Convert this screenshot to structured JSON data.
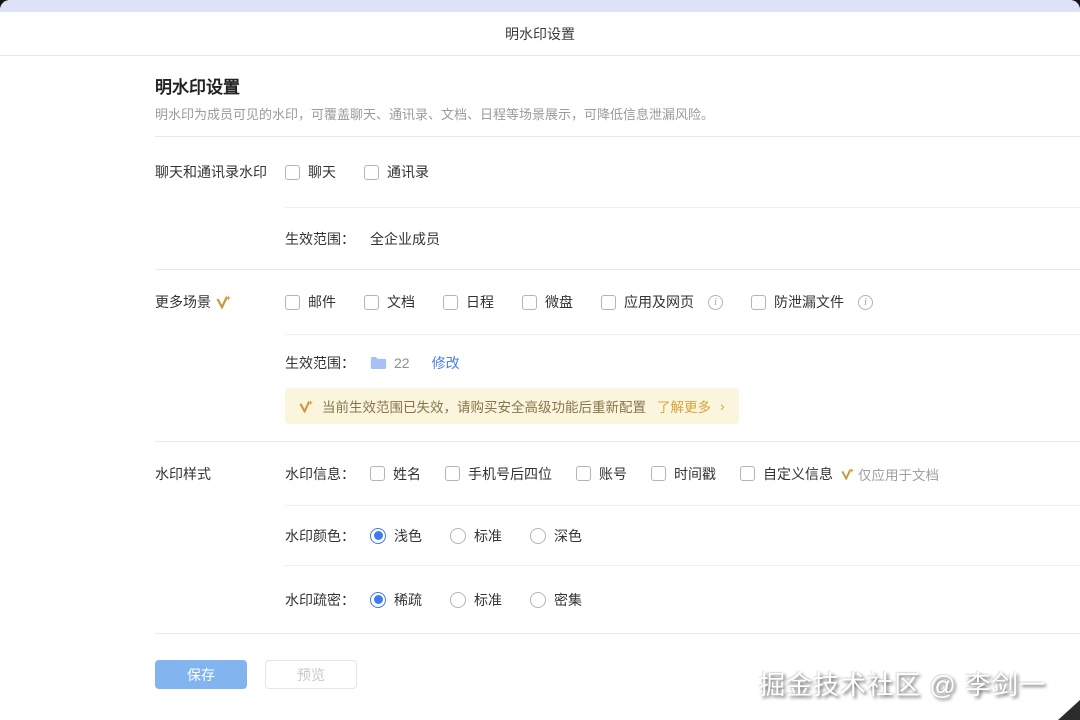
{
  "header": {
    "title": "明水印设置"
  },
  "page": {
    "title": "明水印设置",
    "subtitle": "明水印为成员可见的水印，可覆盖聊天、通讯录、文档、日程等场景展示，可降低信息泄漏风险。"
  },
  "section_chat": {
    "label": "聊天和通讯录水印",
    "checkboxes": [
      {
        "label": "聊天",
        "checked": false
      },
      {
        "label": "通讯录",
        "checked": false
      }
    ],
    "scope_label": "生效范围：",
    "scope_value": "全企业成员"
  },
  "section_more": {
    "label": "更多场景",
    "checkboxes": [
      {
        "label": "邮件",
        "checked": false
      },
      {
        "label": "文档",
        "checked": false
      },
      {
        "label": "日程",
        "checked": false
      },
      {
        "label": "微盘",
        "checked": false
      },
      {
        "label": "应用及网页",
        "checked": false,
        "info": true
      },
      {
        "label": "防泄漏文件",
        "checked": false,
        "info": true
      }
    ],
    "scope_label": "生效范围：",
    "scope_count": "22",
    "modify_link": "修改",
    "banner": {
      "text": "当前生效范围已失效，请购买安全高级功能后重新配置",
      "link": "了解更多",
      "chevron": "›"
    }
  },
  "section_style": {
    "label": "水印样式",
    "info_label": "水印信息：",
    "info_checkboxes": [
      {
        "label": "姓名",
        "checked": false
      },
      {
        "label": "手机号后四位",
        "checked": false
      },
      {
        "label": "账号",
        "checked": false
      },
      {
        "label": "时间戳",
        "checked": false
      },
      {
        "label": "自定义信息",
        "checked": false
      }
    ],
    "info_note": "仅应用于文档",
    "color_label": "水印颜色：",
    "color_options": [
      {
        "label": "浅色",
        "selected": true
      },
      {
        "label": "标准",
        "selected": false
      },
      {
        "label": "深色",
        "selected": false
      }
    ],
    "density_label": "水印疏密：",
    "density_options": [
      {
        "label": "稀疏",
        "selected": true
      },
      {
        "label": "标准",
        "selected": false
      },
      {
        "label": "密集",
        "selected": false
      }
    ]
  },
  "footer": {
    "save": "保存",
    "preview": "预览"
  },
  "icons": {
    "info_glyph": "i",
    "folder": "folder-icon",
    "sparkle": "premium-sparkle-icon"
  },
  "colors": {
    "accent_blue": "#4a7deb",
    "radio_blue": "#3e7bf0",
    "save_button": "#82b4f0",
    "banner_bg": "#fcf5de",
    "banner_gold": "#d7a43e",
    "top_strip": "#dde2f6"
  },
  "watermark": "掘金技术社区 @ 李剑一"
}
